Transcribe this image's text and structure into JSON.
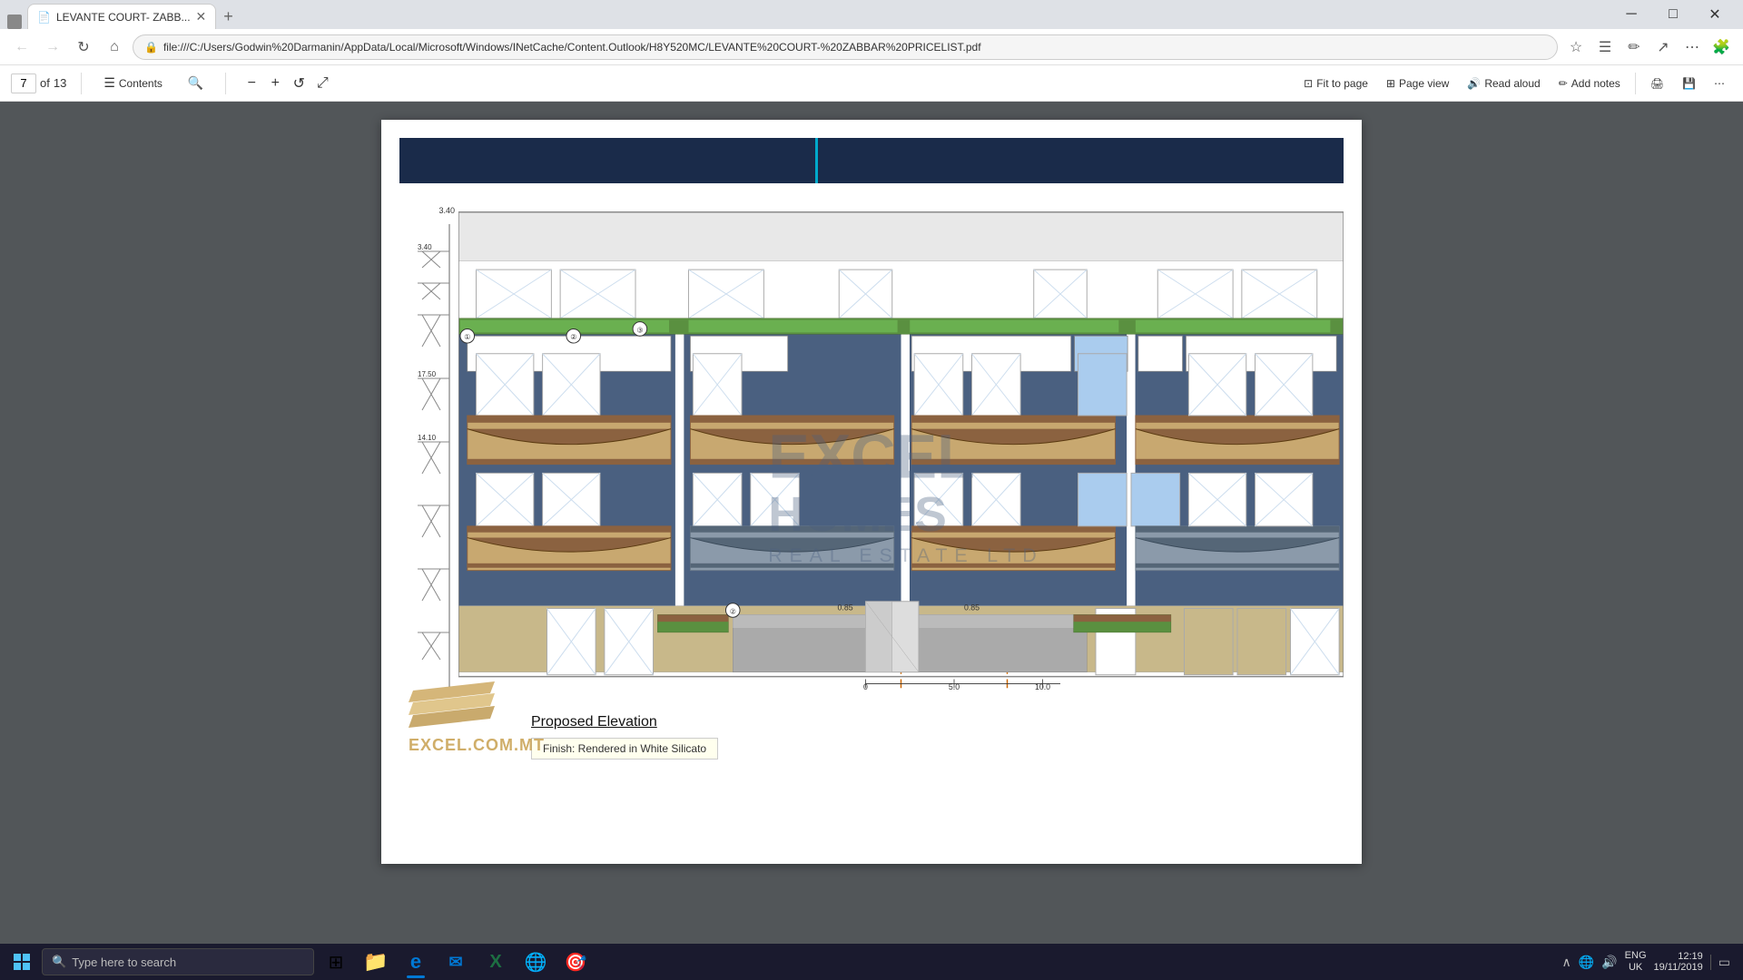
{
  "browser": {
    "tab_title": "LEVANTE COURT- ZABB...",
    "tab_favicon": "📄",
    "address_url": "file:///C:/Users/Godwin%20Darmanin/AppData/Local/Microsoft/Windows/INetCache/Content.Outlook/H8Y520MC/LEVANTE%20COURT-%20ZABBAR%20PRICELIST.pdf",
    "back_btn": "←",
    "forward_btn": "→",
    "refresh_btn": "↻",
    "home_btn": "⌂",
    "minimize_btn": "─",
    "maximize_btn": "□",
    "close_btn": "✕",
    "new_tab_btn": "+"
  },
  "pdf_toolbar": {
    "page_current": "7",
    "page_total": "13",
    "contents_label": "Contents",
    "fit_to_page_label": "Fit to page",
    "page_view_label": "Page view",
    "read_aloud_label": "Read aloud",
    "add_notes_label": "Add notes"
  },
  "drawing": {
    "proposed_elevation_label": "Proposed Elevation",
    "note_label": "Finish: Rendered in White Silicato",
    "dimension_340": "3.40",
    "dimension_1750": "17.50",
    "dimension_1410": "14.10"
  },
  "taskbar": {
    "search_placeholder": "Type here to search",
    "time": "12:19",
    "date": "19/11/2019",
    "language": "ENG",
    "region": "UK",
    "apps": [
      {
        "icon": "⊞",
        "name": "task-view",
        "active": false
      },
      {
        "icon": "📁",
        "name": "file-explorer",
        "active": false
      },
      {
        "icon": "✉",
        "name": "outlook",
        "active": true
      },
      {
        "icon": "X",
        "name": "excel",
        "active": false
      },
      {
        "icon": "🌐",
        "name": "chrome",
        "active": false
      },
      {
        "icon": "🎯",
        "name": "app6",
        "active": false
      }
    ]
  },
  "colors": {
    "building_dark": "#4a6080",
    "building_medium": "#6a7f99",
    "window_frame": "#c8d4e0",
    "balcony_wood": "#8b6240",
    "balcony_rail": "#c8a870",
    "header_dark": "#1a2b4a",
    "accent_teal": "#00aacc",
    "logo_gold": "#c8a050"
  }
}
